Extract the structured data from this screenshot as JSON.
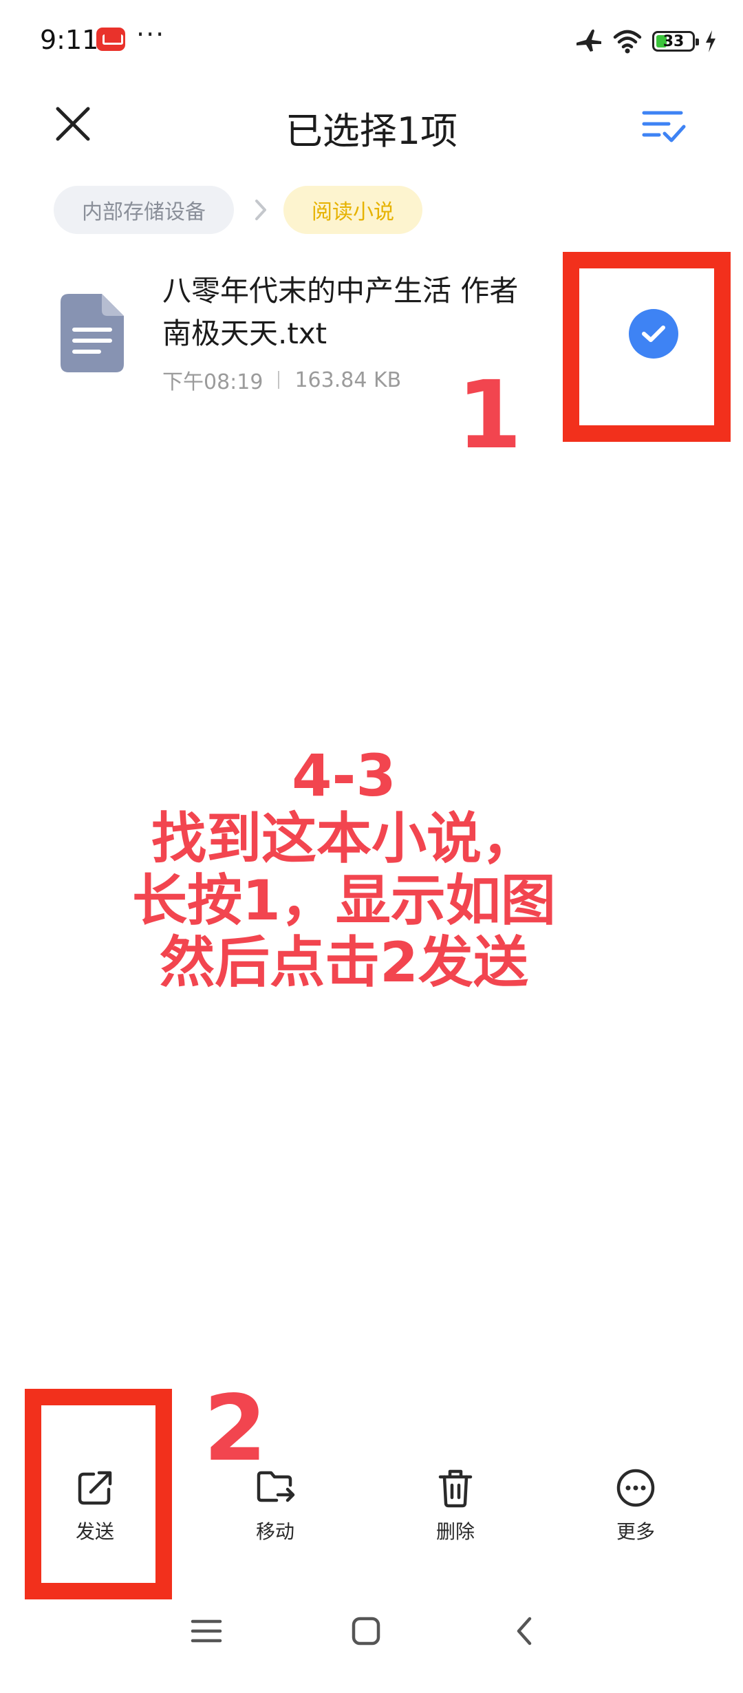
{
  "status_bar": {
    "time": "9:11",
    "dots": "···",
    "battery_level": "33",
    "icons": [
      "app-badge-icon",
      "airplane-icon",
      "wifi-icon",
      "battery-icon",
      "charging-icon"
    ]
  },
  "header": {
    "title": "已选择1项",
    "close_icon": "close-icon",
    "select_all_icon": "select-all-icon"
  },
  "breadcrumb": {
    "root": "内部存储设备",
    "current": "阅读小说"
  },
  "file": {
    "name_line1": "八零年代末的中产生活 作者",
    "name_line2": "南极天天.txt",
    "time": "下午08:19",
    "size": "163.84 KB",
    "selected": true,
    "icon": "text-file-icon"
  },
  "annotations": {
    "marker_1": "1",
    "marker_2": "2",
    "lines": [
      "4-3",
      "找到这本小说，",
      "长按1，显示如图",
      "然后点击2发送"
    ],
    "color": "#f2454f",
    "box_color": "#f2301c"
  },
  "toolbar": {
    "items": [
      {
        "label": "发送",
        "icon": "share-icon"
      },
      {
        "label": "移动",
        "icon": "move-folder-icon"
      },
      {
        "label": "删除",
        "icon": "trash-icon"
      },
      {
        "label": "更多",
        "icon": "more-icon"
      }
    ]
  },
  "nav_bar": {
    "icons": [
      "menu-icon",
      "home-icon",
      "back-icon"
    ]
  },
  "colors": {
    "accent": "#3e83f4",
    "breadcrumb_current_bg": "#fdf4cf",
    "breadcrumb_current_text": "#e6b200"
  }
}
